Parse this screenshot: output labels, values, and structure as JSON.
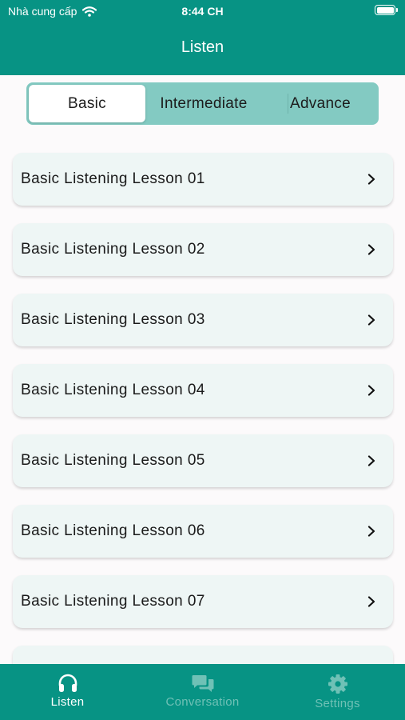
{
  "status_bar": {
    "carrier": "Nhà cung cấp",
    "time": "8:44 CH"
  },
  "header": {
    "title": "Listen"
  },
  "segments": [
    {
      "label": "Basic",
      "selected": true
    },
    {
      "label": "Intermediate",
      "selected": false
    },
    {
      "label": "Advance",
      "selected": false
    }
  ],
  "lessons": [
    "Basic Listening Lesson 01",
    "Basic Listening Lesson 02",
    "Basic Listening Lesson 03",
    "Basic Listening Lesson 04",
    "Basic Listening Lesson 05",
    "Basic Listening Lesson 06",
    "Basic Listening Lesson 07"
  ],
  "tabbar": [
    {
      "label": "Listen",
      "icon": "headphones-icon",
      "active": true
    },
    {
      "label": "Conversation",
      "icon": "chat-bubbles-icon",
      "active": false
    },
    {
      "label": "Settings",
      "icon": "gear-icon",
      "active": false
    }
  ],
  "colors": {
    "primary": "#079384",
    "segment_bg": "#83cac2",
    "card_bg": "#eef6f5",
    "inactive_tab": "#6fc1b6"
  }
}
